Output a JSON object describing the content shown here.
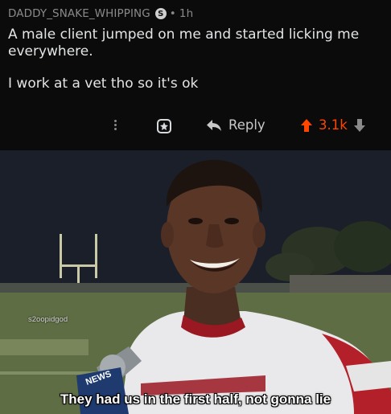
{
  "comment": {
    "username": "DADDY_SNAKE_WHIPPING",
    "badge": "S",
    "separator": "•",
    "age": "1h",
    "lines": [
      "A male client jumped on me and started licking me everywhere.",
      "I work at a vet tho so it's ok"
    ],
    "reply_label": "Reply",
    "score": "3.1k",
    "colors": {
      "score": "#ff4500"
    },
    "icons": [
      "more-icon",
      "award-icon",
      "reply-icon",
      "upvote-icon",
      "downvote-icon"
    ]
  },
  "meme": {
    "caption": "They had us in the first half, not gonna lie",
    "watermark": "s2oopidgod"
  }
}
